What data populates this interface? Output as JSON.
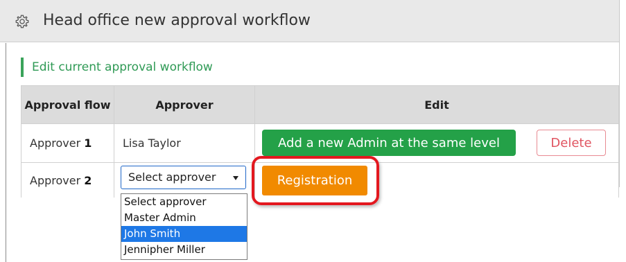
{
  "header": {
    "icon": "gear-icon",
    "title": "Head office new approval workflow",
    "background": "#e9e9e9"
  },
  "section": {
    "title": "Edit current approval workflow",
    "accent_color": "#2f9a55"
  },
  "table": {
    "columns": [
      "Approval flow",
      "Approver",
      "Edit"
    ],
    "rows": [
      {
        "flow_prefix": "Approver",
        "flow_number": "1",
        "approver": "Lisa Taylor",
        "add_button_label": "Add a new Admin at the same level",
        "delete_button_label": "Delete"
      },
      {
        "flow_prefix": "Approver",
        "flow_number": "2",
        "select_value": "Select approver",
        "registration_button_label": "Registration"
      }
    ]
  },
  "dropdown": {
    "options": [
      "Select approver",
      "Master Admin",
      "John Smith",
      "Jennipher Miller"
    ],
    "highlighted_index": 2
  },
  "colors": {
    "add_button": "#24a148",
    "delete_button_text": "#e05561",
    "registration_button": "#f18a00",
    "highlight_ring": "#e3181f",
    "dropdown_highlight": "#1e78e6"
  }
}
